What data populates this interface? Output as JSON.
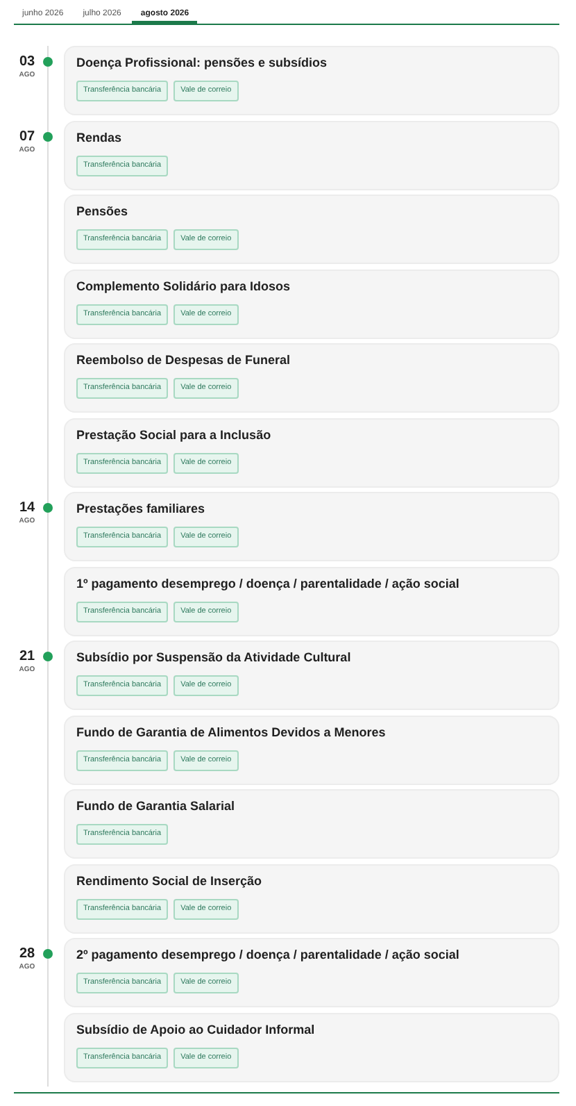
{
  "tabs": [
    {
      "label": "junho 2026",
      "selected": false
    },
    {
      "label": "julho 2026",
      "selected": false
    },
    {
      "label": "agosto 2026",
      "selected": true
    }
  ],
  "groups": [
    {
      "day": "03",
      "month": "AGO",
      "items": [
        {
          "title": "Doença Profissional: pensões e subsídios",
          "tags": [
            "Transferência bancária",
            "Vale de correio"
          ]
        }
      ]
    },
    {
      "day": "07",
      "month": "AGO",
      "items": [
        {
          "title": "Rendas",
          "tags": [
            "Transferência bancária"
          ]
        },
        {
          "title": "Pensões",
          "tags": [
            "Transferência bancária",
            "Vale de correio"
          ]
        },
        {
          "title": "Complemento Solidário para Idosos",
          "tags": [
            "Transferência bancária",
            "Vale de correio"
          ]
        },
        {
          "title": "Reembolso de Despesas de Funeral",
          "tags": [
            "Transferência bancária",
            "Vale de correio"
          ]
        },
        {
          "title": "Prestação Social para a Inclusão",
          "tags": [
            "Transferência bancária",
            "Vale de correio"
          ]
        }
      ]
    },
    {
      "day": "14",
      "month": "AGO",
      "items": [
        {
          "title": "Prestações familiares",
          "tags": [
            "Transferência bancária",
            "Vale de correio"
          ]
        },
        {
          "title": "1º pagamento desemprego / doença / parentalidade / ação social",
          "tags": [
            "Transferência bancária",
            "Vale de correio"
          ]
        }
      ]
    },
    {
      "day": "21",
      "month": "AGO",
      "items": [
        {
          "title": "Subsídio por Suspensão da Atividade Cultural",
          "tags": [
            "Transferência bancária",
            "Vale de correio"
          ]
        },
        {
          "title": "Fundo de Garantia de Alimentos Devidos a Menores",
          "tags": [
            "Transferência bancária",
            "Vale de correio"
          ]
        },
        {
          "title": "Fundo de Garantia Salarial",
          "tags": [
            "Transferência bancária"
          ]
        },
        {
          "title": "Rendimento Social de Inserção",
          "tags": [
            "Transferência bancária",
            "Vale de correio"
          ]
        }
      ]
    },
    {
      "day": "28",
      "month": "AGO",
      "items": [
        {
          "title": "2º pagamento desemprego / doença / parentalidade / ação social",
          "tags": [
            "Transferência bancária",
            "Vale de correio"
          ]
        },
        {
          "title": "Subsídio de Apoio ao Cuidador Informal",
          "tags": [
            "Transferência bancária",
            "Vale de correio"
          ]
        }
      ]
    }
  ]
}
